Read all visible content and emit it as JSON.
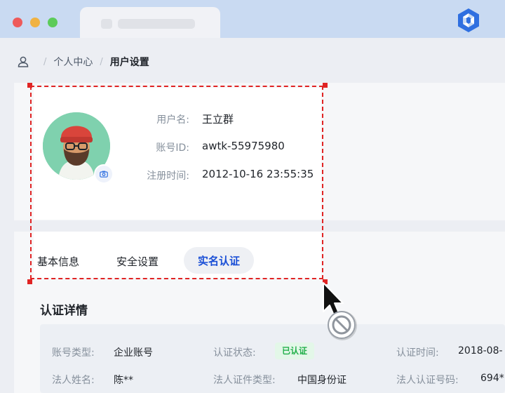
{
  "breadcrumb": {
    "items": [
      "个人中心",
      "用户设置"
    ],
    "separator": "/"
  },
  "profile": {
    "username_label": "用户名:",
    "username": "王立群",
    "account_id_label": "账号ID:",
    "account_id": "awtk-55975980",
    "register_time_label": "注册时间:",
    "register_time": "2012-10-16 23:55:35"
  },
  "tabs": [
    {
      "label": "基本信息",
      "active": false
    },
    {
      "label": "安全设置",
      "active": false
    },
    {
      "label": "实名认证",
      "active": true
    }
  ],
  "certification": {
    "title": "认证详情",
    "account_type_label": "账号类型:",
    "account_type": "企业账号",
    "status_label": "认证状态:",
    "status": "已认证",
    "time_label": "认证时间:",
    "time": "2018-08-",
    "legal_name_label": "法人姓名:",
    "legal_name": "陈**",
    "id_type_label": "法人证件类型:",
    "id_type": "中国身份证",
    "id_number_label": "法人认证号码:",
    "id_number": "694*"
  },
  "colors": {
    "accent": "#1a4fd6",
    "selection": "#e02424",
    "success": "#22b04a",
    "titlebar": "#c9daf2"
  },
  "icons": {
    "breadcrumb": "user-icon",
    "avatar_badge": "camera-icon",
    "cursor": "not-allowed-cursor"
  }
}
